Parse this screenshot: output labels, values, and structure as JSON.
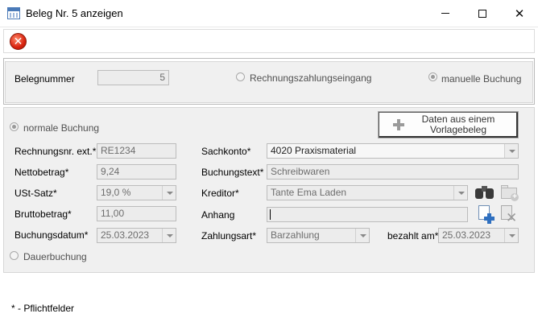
{
  "window": {
    "title": "Beleg Nr. 5 anzeigen",
    "minimize": "",
    "maximize": "",
    "close": "✕"
  },
  "toolbar": {
    "close_icon": "✕"
  },
  "header": {
    "belegnummer_label": "Belegnummer",
    "belegnummer_value": "5",
    "radio_rechnung": "Rechnungszahlungseingang",
    "radio_manuell": "manuelle Buchung"
  },
  "main": {
    "radio_normal": "normale Buchung",
    "radio_dauer": "Dauerbuchung",
    "vorlage_button": "Daten aus einem Vorlagebeleg",
    "rechnungsnr_label": "Rechnungsnr. ext.*",
    "rechnungsnr_value": "RE1234",
    "netto_label": "Nettobetrag*",
    "netto_value": "9,24",
    "ust_label": "USt-Satz*",
    "ust_value": "19,0 %",
    "brutto_label": "Bruttobetrag*",
    "brutto_value": "11,00",
    "buchungsdatum_label": "Buchungsdatum*",
    "buchungsdatum_value": "25.03.2023",
    "sachkonto_label": "Sachkonto*",
    "sachkonto_value": "4020 Praxismaterial",
    "buchungstext_label": "Buchungstext*",
    "buchungstext_value": "Schreibwaren",
    "kreditor_label": "Kreditor*",
    "kreditor_value": "Tante Ema Laden",
    "anhang_label": "Anhang",
    "anhang_value": "",
    "zahlungsart_label": "Zahlungsart*",
    "zahlungsart_value": "Barzahlung",
    "bezahlt_label": "bezahlt am*",
    "bezahlt_value": "25.03.2023"
  },
  "footer": {
    "note": "* - Pflichtfelder"
  }
}
